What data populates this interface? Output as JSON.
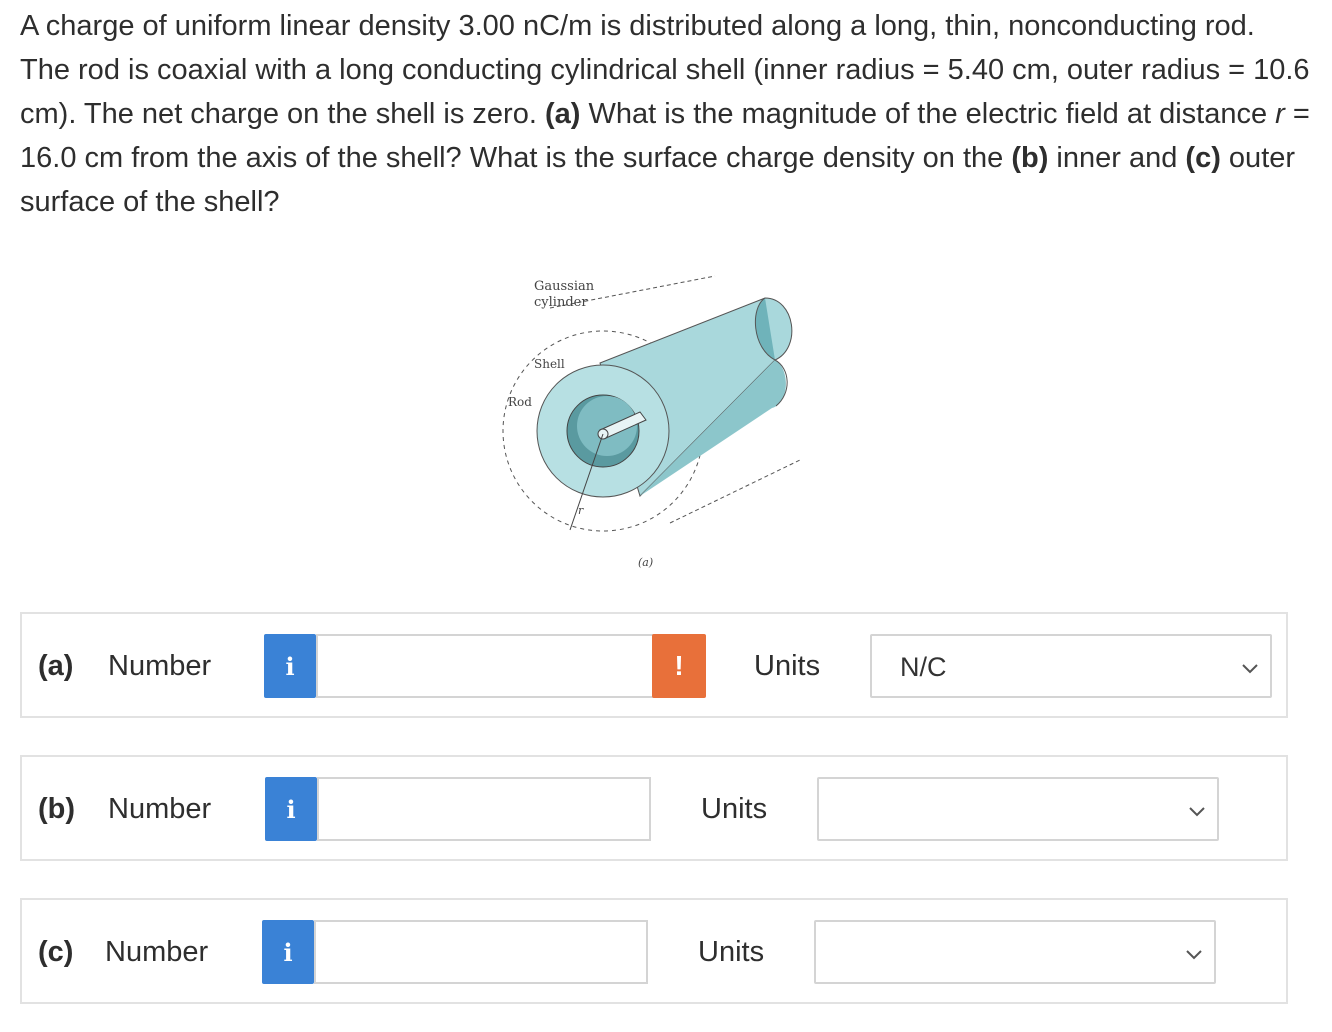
{
  "question": {
    "s1": "A charge of uniform linear density 3.00 nC/m is distributed along a long, thin, nonconducting rod. The rod is coaxial with a long conducting cylindrical shell (inner radius = 5.40 cm, outer radius = 10.6 cm). The net charge on the shell is zero. ",
    "a_tag": "(a)",
    "s2": " What is the magnitude of the electric field at distance ",
    "r_var": "r",
    "s3": " = 16.0 cm from the axis of the shell? What is the surface charge density on the ",
    "b_tag": "(b)",
    "s4": " inner and ",
    "c_tag": "(c)",
    "s5": " outer surface of the shell?"
  },
  "figure": {
    "gaussian_label_1": "Gaussian",
    "gaussian_label_2": "cylinder",
    "shell_label": "Shell",
    "rod_label": "Rod",
    "r_label": "r",
    "caption": "(a)",
    "colors": {
      "shell": "#a9d8dc",
      "shell_dark": "#6fb3ba",
      "inner": "#5a9aa0",
      "rod": "#e8f4f5"
    }
  },
  "answers": [
    {
      "part": "(a)",
      "number_label": "Number",
      "info_icon": "i",
      "value": "",
      "alert": "!",
      "units_label": "Units",
      "units_value": "N/C"
    },
    {
      "part": "(b)",
      "number_label": "Number",
      "info_icon": "i",
      "value": "",
      "units_label": "Units",
      "units_value": ""
    },
    {
      "part": "(c)",
      "number_label": "Number",
      "info_icon": "i",
      "value": "",
      "units_label": "Units",
      "units_value": ""
    }
  ],
  "colors": {
    "info": "#3a82d6",
    "alert": "#e8703a",
    "border": "#e2e2e2"
  }
}
